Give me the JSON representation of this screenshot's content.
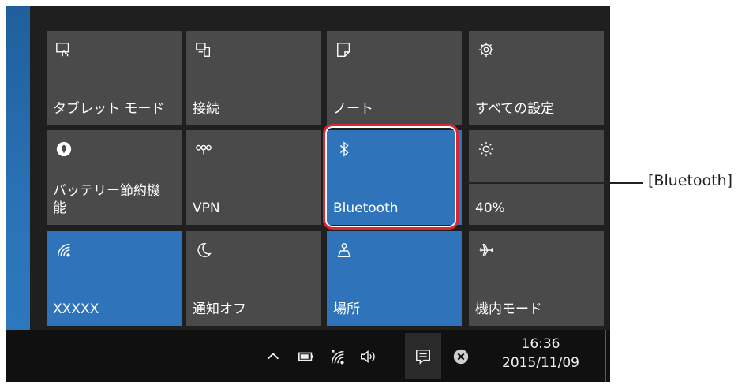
{
  "tiles": [
    {
      "label": "タブレット モード",
      "icon": "tablet-mode-icon"
    },
    {
      "label": "接続",
      "icon": "connect-icon"
    },
    {
      "label": "ノート",
      "icon": "note-icon"
    },
    {
      "label": "すべての設定",
      "icon": "gear-icon"
    },
    {
      "label": "バッテリー節約機\n能",
      "icon": "battery-saver-icon"
    },
    {
      "label": "VPN",
      "icon": "vpn-icon"
    },
    {
      "label": "Bluetooth",
      "icon": "bluetooth-icon"
    },
    {
      "label": "40%",
      "icon": "brightness-icon"
    },
    {
      "label": "XXXXX",
      "icon": "wifi-icon"
    },
    {
      "label": "通知オフ",
      "icon": "quiet-hours-icon"
    },
    {
      "label": "場所",
      "icon": "location-icon"
    },
    {
      "label": "機内モード",
      "icon": "airplane-mode-icon"
    }
  ],
  "callout": {
    "label": "[Bluetooth]"
  },
  "taskbar": {
    "time": "16:36",
    "date": "2015/11/09"
  },
  "colors": {
    "tile_off": "#4a4a4a",
    "tile_on": "#2f74bb",
    "highlight": "#d9262f",
    "taskbar": "#101010"
  }
}
